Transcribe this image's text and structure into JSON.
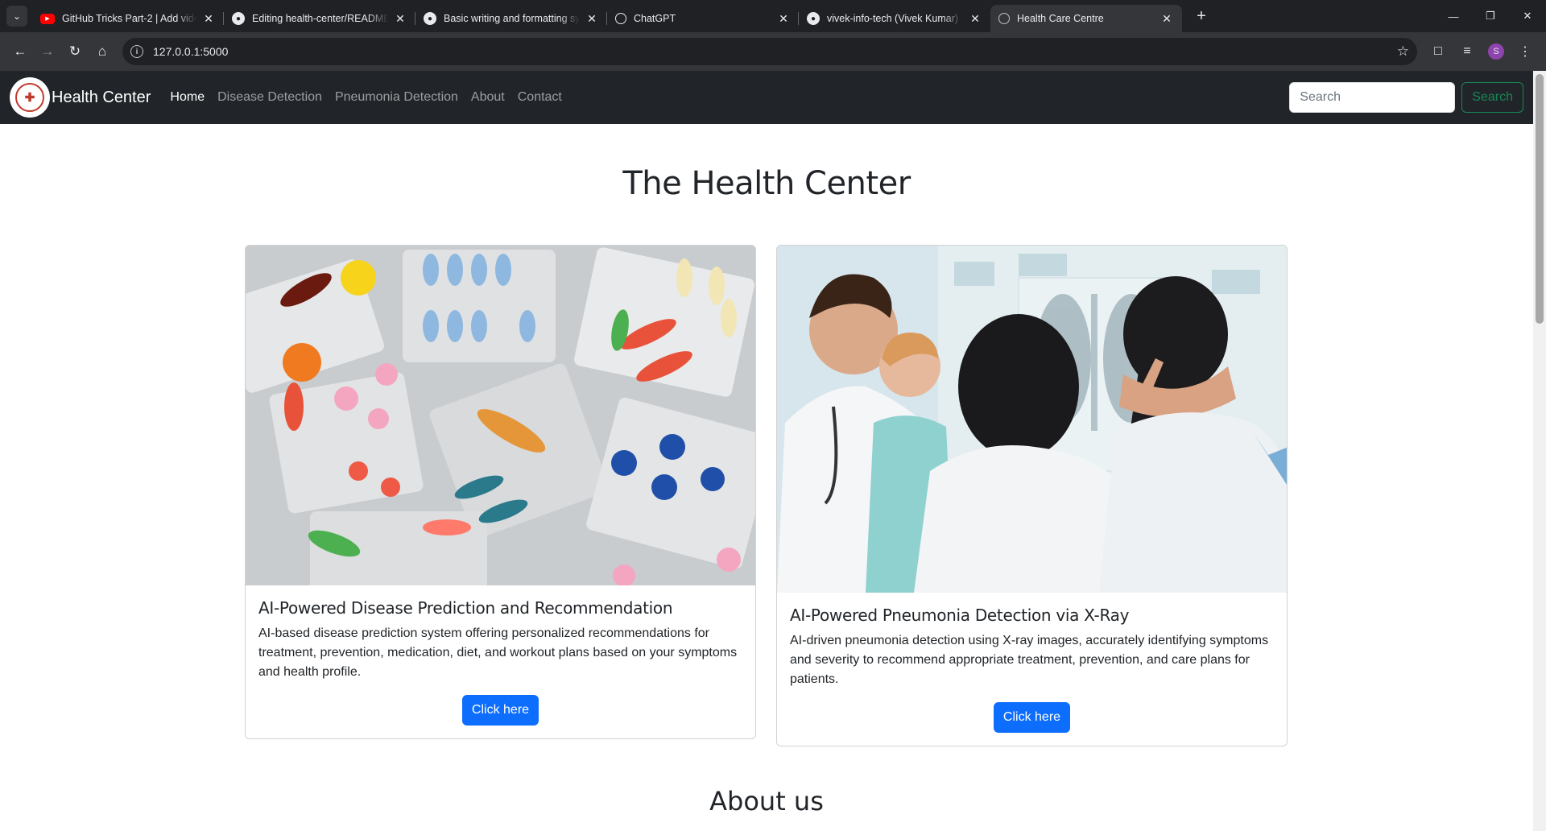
{
  "browser": {
    "tabs": [
      {
        "title": "GitHub Tricks Part-2 | Add video",
        "favicon": "youtube-icon"
      },
      {
        "title": "Editing health-center/README.md",
        "favicon": "github-icon"
      },
      {
        "title": "Basic writing and formatting syntax",
        "favicon": "github-icon"
      },
      {
        "title": "ChatGPT",
        "favicon": "chatgpt-icon"
      },
      {
        "title": "vivek-info-tech (Vivek Kumar)",
        "favicon": "github-icon"
      },
      {
        "title": "Health Care Centre",
        "favicon": "globe-icon",
        "active": true
      }
    ],
    "url": "127.0.0.1:5000",
    "profile_initial": "S"
  },
  "site": {
    "brand": "Health Center",
    "nav": [
      "Home",
      "Disease Detection",
      "Pneumonia Detection",
      "About",
      "Contact"
    ],
    "search_placeholder": "Search",
    "search_button": "Search",
    "page_title": "The Health Center",
    "cards": [
      {
        "title": "AI-Powered Disease Prediction and Recommendation",
        "text": "AI-based disease prediction system offering personalized recommendations for treatment, prevention, medication, diet, and workout plans based on your symptoms and health profile.",
        "button": "Click here",
        "image": "medicine-pills-image"
      },
      {
        "title": "AI-Powered Pneumonia Detection via X-Ray",
        "text": "AI-driven pneumonia detection using X-ray images, accurately identifying symptoms and severity to recommend appropriate treatment, prevention, and care plans for patients.",
        "button": "Click here",
        "image": "doctors-xray-image"
      }
    ],
    "about_title": "About us"
  }
}
